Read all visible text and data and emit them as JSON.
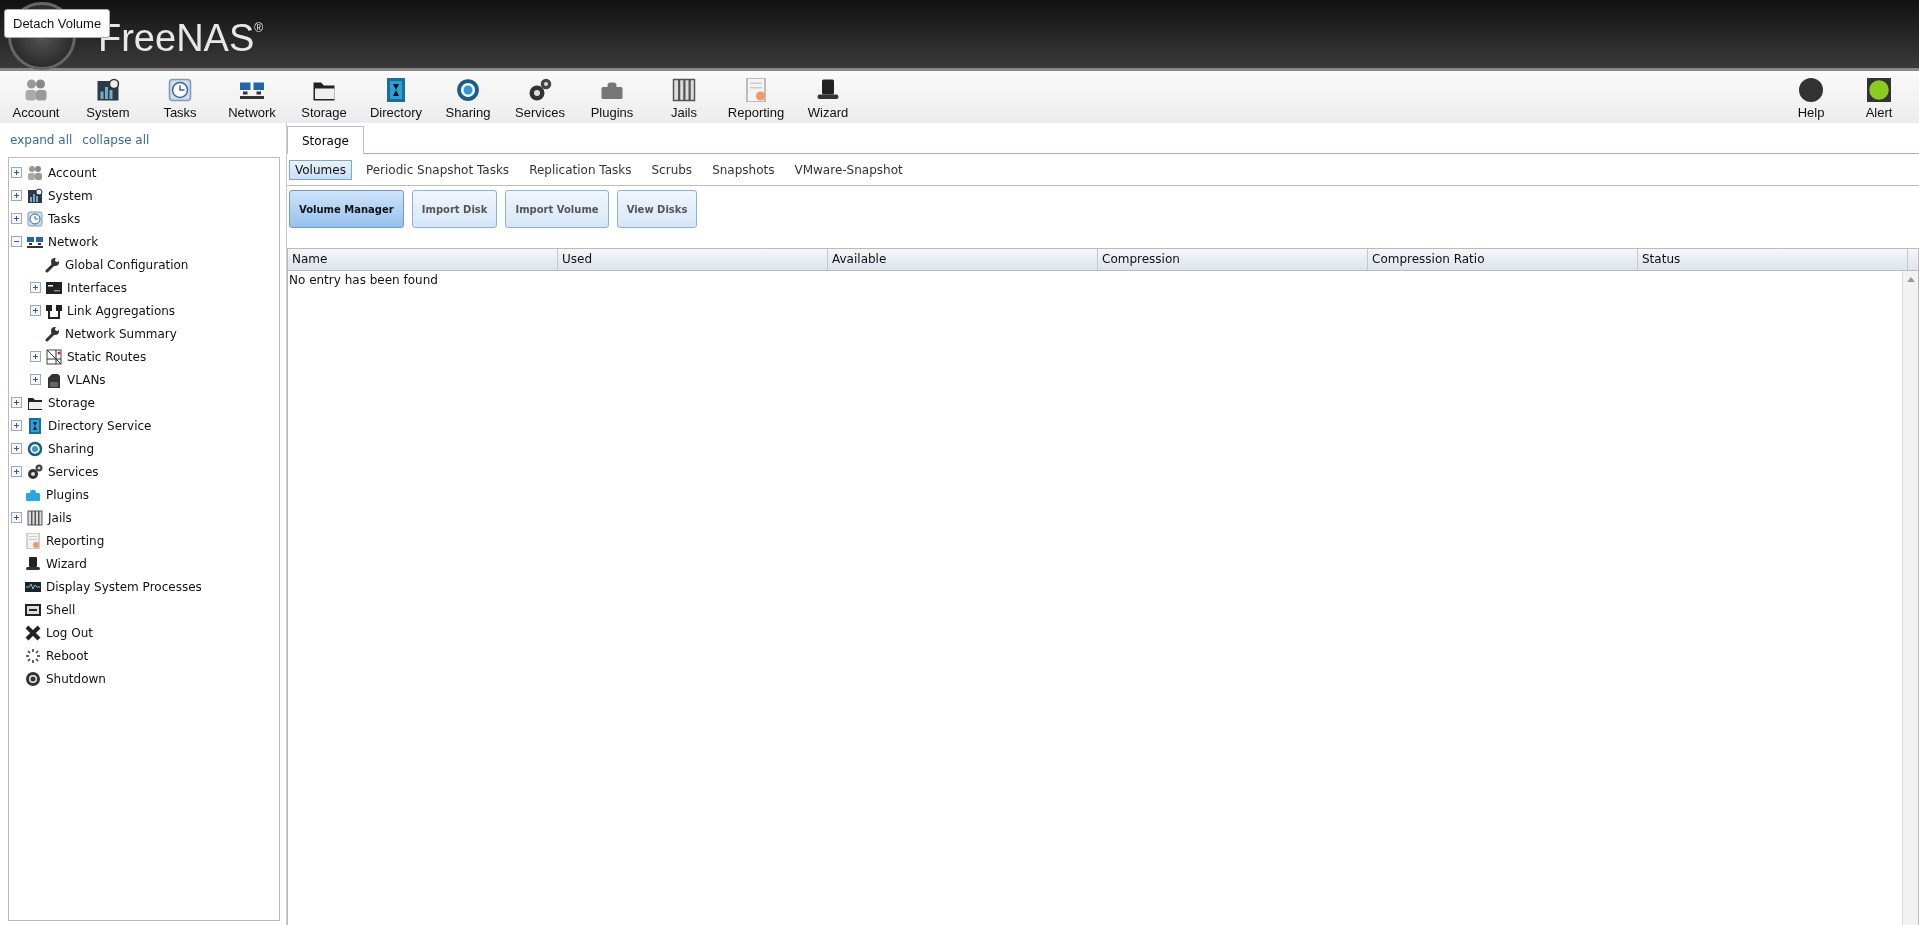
{
  "header": {
    "logo": "FreeNAS",
    "logo_mark": "®",
    "tooltip": "Detach Volume"
  },
  "toolbar": {
    "items": [
      {
        "label": "Account"
      },
      {
        "label": "System"
      },
      {
        "label": "Tasks"
      },
      {
        "label": "Network"
      },
      {
        "label": "Storage"
      },
      {
        "label": "Directory"
      },
      {
        "label": "Sharing"
      },
      {
        "label": "Services"
      },
      {
        "label": "Plugins"
      },
      {
        "label": "Jails"
      },
      {
        "label": "Reporting"
      },
      {
        "label": "Wizard"
      }
    ],
    "right_items": [
      {
        "label": "Help"
      },
      {
        "label": "Alert"
      }
    ]
  },
  "sidebar": {
    "links": [
      "expand all",
      "collapse all"
    ],
    "tree": [
      {
        "label": "Account",
        "kind": "branch",
        "expanded": false
      },
      {
        "label": "System",
        "kind": "branch",
        "expanded": false
      },
      {
        "label": "Tasks",
        "kind": "branch",
        "expanded": false
      },
      {
        "label": "Network",
        "kind": "branch",
        "expanded": true,
        "children": [
          {
            "label": "Global Configuration",
            "kind": "leaf"
          },
          {
            "label": "Interfaces",
            "kind": "branch",
            "expanded": false
          },
          {
            "label": "Link Aggregations",
            "kind": "branch",
            "expanded": false
          },
          {
            "label": "Network Summary",
            "kind": "leaf"
          },
          {
            "label": "Static Routes",
            "kind": "branch",
            "expanded": false
          },
          {
            "label": "VLANs",
            "kind": "branch",
            "expanded": false
          }
        ]
      },
      {
        "label": "Storage",
        "kind": "branch",
        "expanded": false
      },
      {
        "label": "Directory Service",
        "kind": "branch",
        "expanded": false
      },
      {
        "label": "Sharing",
        "kind": "branch",
        "expanded": false
      },
      {
        "label": "Services",
        "kind": "branch",
        "expanded": false
      },
      {
        "label": "Plugins",
        "kind": "leaf"
      },
      {
        "label": "Jails",
        "kind": "branch",
        "expanded": false
      },
      {
        "label": "Reporting",
        "kind": "leaf"
      },
      {
        "label": "Wizard",
        "kind": "leaf"
      },
      {
        "label": "Display System Processes",
        "kind": "leaf"
      },
      {
        "label": "Shell",
        "kind": "leaf"
      },
      {
        "label": "Log Out",
        "kind": "leaf"
      },
      {
        "label": "Reboot",
        "kind": "leaf"
      },
      {
        "label": "Shutdown",
        "kind": "leaf"
      }
    ]
  },
  "tabs": [
    {
      "label": "Storage",
      "selected": true
    }
  ],
  "subtabs": [
    {
      "label": "Volumes",
      "selected": true
    },
    {
      "label": "Periodic Snapshot Tasks",
      "selected": false
    },
    {
      "label": "Replication Tasks",
      "selected": false
    },
    {
      "label": "Scrubs",
      "selected": false
    },
    {
      "label": "Snapshots",
      "selected": false
    },
    {
      "label": "VMware-Snapshot",
      "selected": false
    }
  ],
  "buttons": [
    {
      "label": "Volume Manager",
      "kind": "primary"
    },
    {
      "label": "Import Disk",
      "kind": "normal"
    },
    {
      "label": "Import Volume",
      "kind": "normal"
    },
    {
      "label": "View Disks",
      "kind": "normal"
    }
  ],
  "table": {
    "columns": [
      "Name",
      "Used",
      "Available",
      "Compression",
      "Compression Ratio",
      "Status"
    ],
    "empty_message": "No entry has been found"
  }
}
